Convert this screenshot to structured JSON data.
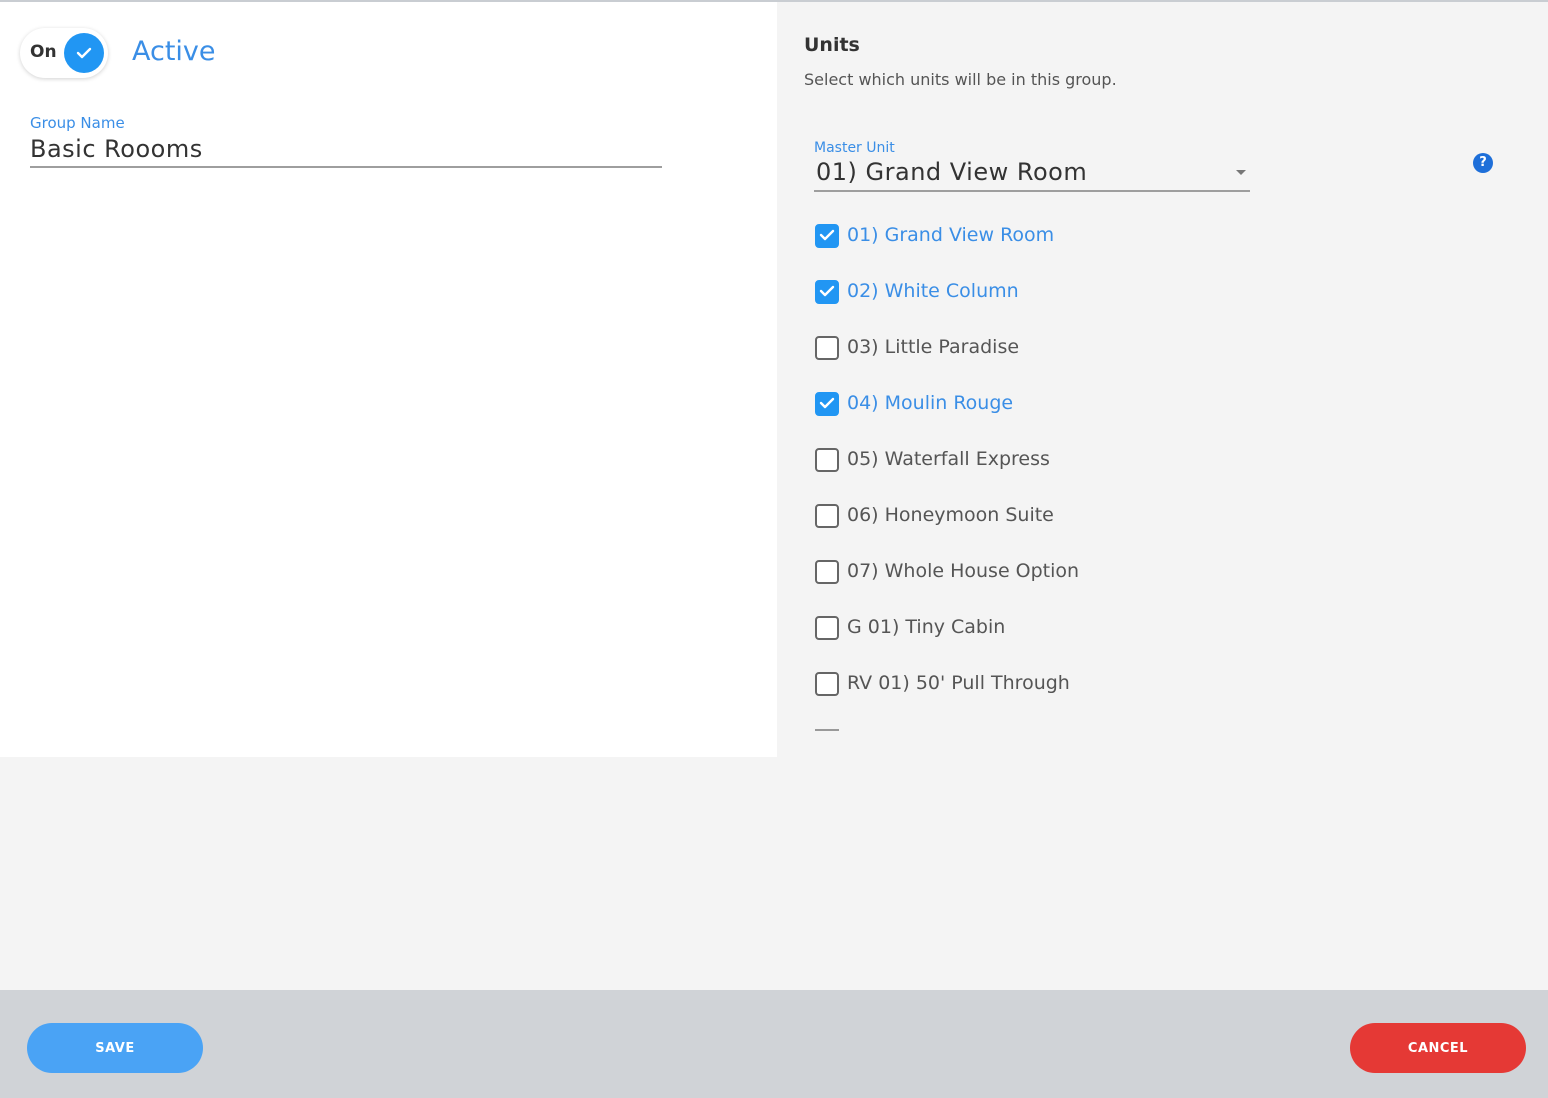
{
  "toggle": {
    "label": "On",
    "state": true
  },
  "status": {
    "label": "Active"
  },
  "group_name": {
    "label": "Group Name",
    "value": "Basic Roooms"
  },
  "units": {
    "title": "Units",
    "description": "Select which units will be in this group.",
    "master_unit": {
      "label": "Master Unit",
      "value": "01) Grand View Room"
    },
    "help_icon": "?",
    "items": [
      {
        "label": "01) Grand View Room",
        "checked": true
      },
      {
        "label": "02) White Column",
        "checked": true
      },
      {
        "label": "03) Little Paradise",
        "checked": false
      },
      {
        "label": "04) Moulin Rouge",
        "checked": true
      },
      {
        "label": "05) Waterfall Express",
        "checked": false
      },
      {
        "label": "06) Honeymoon Suite",
        "checked": false
      },
      {
        "label": "07) Whole House Option",
        "checked": false
      },
      {
        "label": "G 01) Tiny Cabin",
        "checked": false
      },
      {
        "label": "RV 01) 50' Pull Through",
        "checked": false
      }
    ]
  },
  "footer": {
    "save_label": "SAVE",
    "cancel_label": "CANCEL"
  },
  "colors": {
    "accent": "#2196f3",
    "link": "#3a8ee6",
    "danger": "#e53935",
    "save": "#4aa3f5"
  }
}
